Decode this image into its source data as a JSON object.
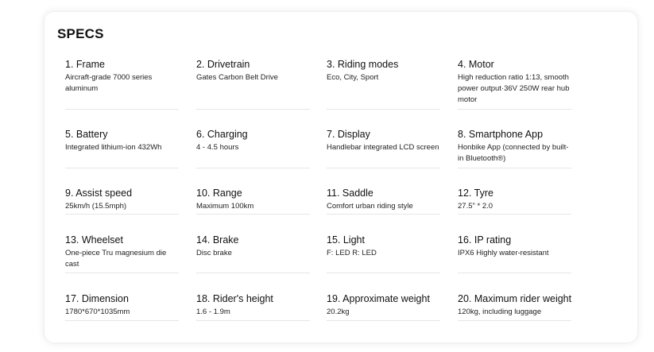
{
  "section": {
    "title": "SPECS"
  },
  "specs": [
    {
      "title": "1. Frame",
      "value": "Aircraft-grade 7000 series aluminum"
    },
    {
      "title": "2. Drivetrain",
      "value": "Gates Carbon Belt Drive"
    },
    {
      "title": "3. Riding modes",
      "value": "Eco, City, Sport"
    },
    {
      "title": "4. Motor",
      "value": "High reduction ratio 1:13, smooth power output·36V 250W rear hub motor"
    },
    {
      "title": "5. Battery",
      "value": "Integrated lithium-ion 432Wh"
    },
    {
      "title": "6. Charging",
      "value": "4 - 4.5 hours"
    },
    {
      "title": "7. Display",
      "value": "Handlebar integrated LCD screen"
    },
    {
      "title": "8. Smartphone App",
      "value": "Honbike App (connected by built-in Bluetooth®)"
    },
    {
      "title": "9. Assist speed",
      "value": "25km/h (15.5mph)"
    },
    {
      "title": "10. Range",
      "value": "Maximum 100km"
    },
    {
      "title": "11. Saddle",
      "value": "Comfort urban riding style"
    },
    {
      "title": "12. Tyre",
      "value": "27.5\" * 2.0"
    },
    {
      "title": "13. Wheelset",
      "value": "One-piece Tru magnesium die cast"
    },
    {
      "title": "14. Brake",
      "value": "Disc brake"
    },
    {
      "title": "15. Light",
      "value": "F: LED R: LED"
    },
    {
      "title": "16. IP rating",
      "value": "IPX6 Highly water-resistant"
    },
    {
      "title": "17. Dimension",
      "value": "1780*670*1035mm"
    },
    {
      "title": "18. Rider's height",
      "value": "1.6 - 1.9m"
    },
    {
      "title": "19. Approximate weight",
      "value": "20.2kg"
    },
    {
      "title": "20. Maximum rider weight",
      "value": "120kg, including luggage"
    }
  ]
}
